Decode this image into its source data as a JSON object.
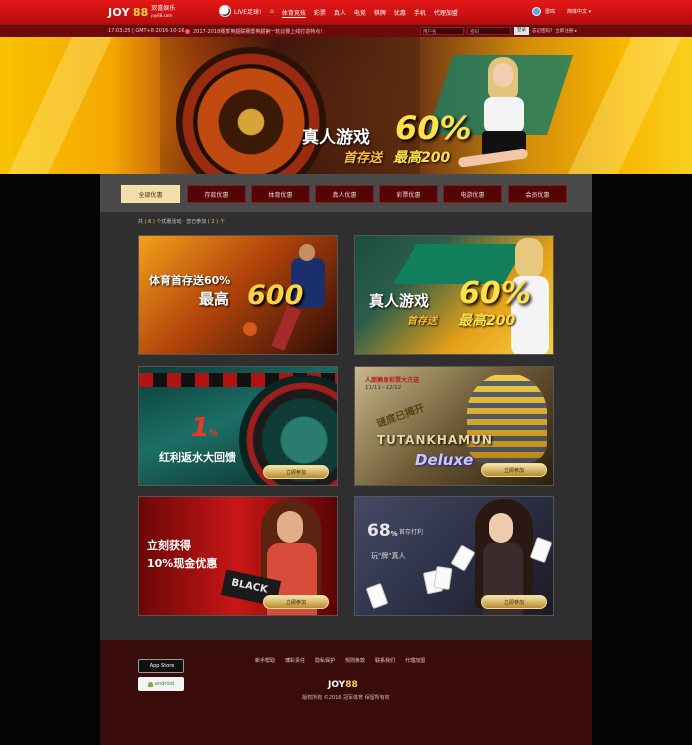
{
  "topnav": {
    "logo_text": "JOY",
    "logo_num": "88",
    "logo_cn": "双喜娱乐",
    "logo_domain": "joy88.com",
    "live_label": "LIVE足球!",
    "menu": [
      "体育竞技",
      "彩票",
      "真人",
      "电竞",
      "棋牌",
      "优惠",
      "手机",
      "代理加盟"
    ],
    "active_index": 0,
    "user_name": "雷鸣",
    "user_menu": "简体中文 ▾"
  },
  "subbar": {
    "time": "17:03:25 | GMT+8 2016-10-16",
    "notice": "2017-2018赛季英超联赛暨英超第一轮比赛上线打造特点!",
    "username_placeholder": "用户名",
    "password_placeholder": "密码",
    "login_button": "登录",
    "forgot_link": "忘记密码?",
    "register_link": "立即注册 ▸"
  },
  "hero": {
    "title": "真人游戏",
    "percent": "60%",
    "first_deposit": "首存送",
    "max": "最高200"
  },
  "tabs": [
    "全部优惠",
    "存款优惠",
    "体育优惠",
    "真人优惠",
    "彩票优惠",
    "电游优惠",
    "会员优惠"
  ],
  "active_tab": 0,
  "summary": {
    "prefix": "共",
    "count1": "6",
    "mid": "个优惠活动 · 您已参加",
    "count2": "2",
    "suffix": "个"
  },
  "cards": {
    "sports": {
      "line1": "体育首存送60%",
      "line2": "最高",
      "amount": "600"
    },
    "live": {
      "title": "真人游戏",
      "percent": "60%",
      "line1": "首存送",
      "line2": "最高200"
    },
    "rebate": {
      "percent": "1",
      "percent_unit": "%",
      "text": "红利返水大回馈",
      "button": "立即参加"
    },
    "slot": {
      "title": "人面狮身彩票大方送",
      "date": "11/11~12/12",
      "stamp": "谜底已揭开",
      "brand": "TUTANKHAMUN",
      "sub": "Deluxe",
      "button": "立即参加"
    },
    "cash": {
      "line1": "立刻获得",
      "line2": "10%现金优惠",
      "card_text": "BLACK",
      "button": "立即参加"
    },
    "poker": {
      "big": "68",
      "big_unit": "%",
      "line1": "首存打利",
      "line2": "玩\"牌\"真人",
      "button": "立即参加"
    }
  },
  "footer": {
    "appstore": "App Store",
    "android": "android",
    "links": [
      "新手帮助",
      "博彩责任",
      "隐私保护",
      "规则条款",
      "联系我们",
      "代理加盟"
    ],
    "logo_text": "JOY",
    "logo_num": "88",
    "copyright": "版权所有 ©2016 冠军体育 保留所有权"
  }
}
